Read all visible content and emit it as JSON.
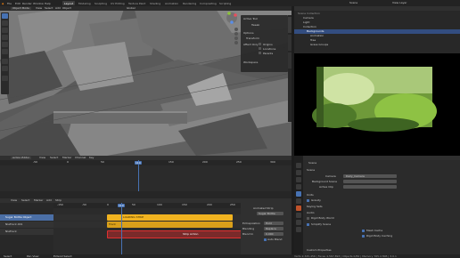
{
  "menu": [
    "File",
    "Edit",
    "Render",
    "Window",
    "Help"
  ],
  "workspaces": [
    "Layout",
    "Modeling",
    "Sculpting",
    "UV Editing",
    "Texture Paint",
    "Shading",
    "Animation",
    "Rendering",
    "Compositing",
    "Scripting"
  ],
  "scene": "Scene",
  "view_layer": "View Layer",
  "viewport": {
    "mode": "Object Mode",
    "menus": [
      "View",
      "Select",
      "Add",
      "Object"
    ],
    "orientation": "Global"
  },
  "npanel": {
    "active_tool": "Active Tool",
    "tweak": "Tweak",
    "options": "Options",
    "transform": "Transform",
    "affect_only": "Affect Only",
    "origins": "Origins",
    "locations": "Locations",
    "parents": "Parents",
    "workspace": "Workspace"
  },
  "outliner": {
    "title": "Scene Collection",
    "rows": [
      "Scene Collection",
      "Camera",
      "Light",
      "Collection",
      "Backgrounds",
      "Animation",
      "Tree",
      "Grass Groups"
    ]
  },
  "timeline": {
    "title": "Action Editor",
    "menus": [
      "View",
      "Select",
      "Marker",
      "Channel",
      "Key"
    ],
    "ticks": [
      "-50",
      "0",
      "50",
      "100",
      "150",
      "200",
      "250",
      "300"
    ],
    "frame": "110"
  },
  "nla": {
    "menus": [
      "View",
      "Select",
      "Marker",
      "Add",
      "Strip"
    ],
    "tracks": [
      "Sugar Bottle Object",
      "NlaTrack.001",
      "NlaTrack"
    ],
    "strips": [
      "LOADING STRIP",
      "Track",
      "Strip Action"
    ],
    "ticks": [
      "-150",
      "-50",
      "0",
      "50",
      "100",
      "150",
      "200",
      "250"
    ],
    "frame": "110",
    "sidebar": {
      "title": "Animated Strip",
      "strip": "Sugar Bottle",
      "extrapolation": "Hold",
      "blending": "Replace",
      "influence": "0.000",
      "rows": [
        "Extrapolation",
        "Blending",
        "Blend In",
        "Auto Blend"
      ]
    }
  },
  "properties": {
    "scene": "Scene",
    "camera_label": "Camera",
    "camera_value": "Daily_Camera",
    "background_label": "Background Scene",
    "active_clip": "Active Clip",
    "units": "Units",
    "gravity": "Gravity",
    "keying_sets": "Keying Sets",
    "audio": "Audio",
    "rigid_body": "Rigid Body World",
    "simplify": "Simplify Scene",
    "mesh_cache": "Mesh Cache",
    "rigid_cache": "Rigid Body Caching",
    "custom_props": "Custom Properties"
  },
  "status": {
    "left": "Select",
    "mid": "Pan View",
    "right": "Extend Select",
    "version": "Verts 2,345,456 | Faces 4,567,893 | Objects 0/82 | Memory 765.4 MiB | 3.0.1"
  }
}
